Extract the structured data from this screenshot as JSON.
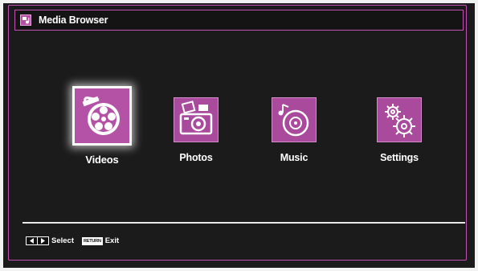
{
  "header": {
    "title": "Media Browser",
    "icon": "media-browser-icon"
  },
  "menu": {
    "items": [
      {
        "label": "Videos",
        "icon": "film-reel-icon",
        "selected": true
      },
      {
        "label": "Photos",
        "icon": "camera-photos-icon",
        "selected": false
      },
      {
        "label": "Music",
        "icon": "music-disc-icon",
        "selected": false
      },
      {
        "label": "Settings",
        "icon": "gears-icon",
        "selected": false
      }
    ]
  },
  "footer": {
    "select_label": "Select",
    "return_key_label": "RETURN",
    "exit_label": "Exit"
  },
  "colors": {
    "accent": "#b452a6",
    "frame": "#c04fb0",
    "background": "#1b1b1b"
  }
}
